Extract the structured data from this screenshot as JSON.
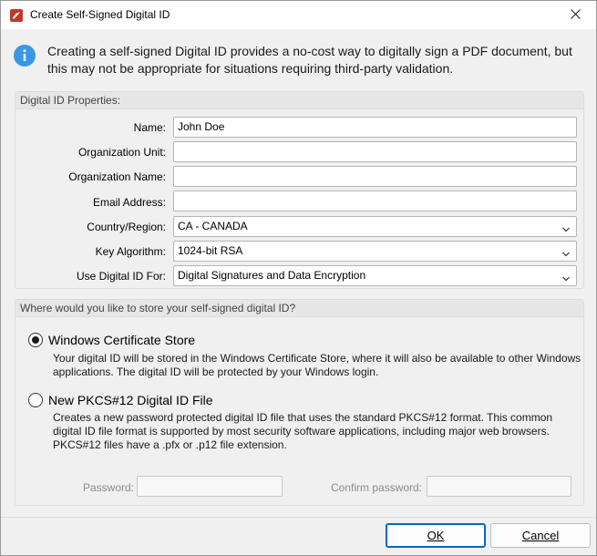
{
  "window": {
    "title": "Create Self-Signed Digital ID"
  },
  "info": {
    "text": "Creating a self-signed Digital ID provides a no-cost way to digitally sign a PDF document, but this may not be appropriate for situations requiring third-party validation."
  },
  "properties": {
    "header": "Digital ID Properties:",
    "name_label": "Name:",
    "name_value": "John Doe",
    "org_unit_label": "Organization Unit:",
    "org_unit_value": "",
    "org_name_label": "Organization Name:",
    "org_name_value": "",
    "email_label": "Email Address:",
    "email_value": "",
    "country_label": "Country/Region:",
    "country_value": "CA - CANADA",
    "key_label": "Key Algorithm:",
    "key_value": "1024-bit RSA",
    "use_label": "Use Digital ID For:",
    "use_value": "Digital Signatures and Data Encryption"
  },
  "storage": {
    "header": "Where would you like to store your self-signed digital ID?",
    "option1_label": "Windows Certificate Store",
    "option1_desc": "Your digital ID will be stored in the Windows Certificate Store, where it will also be available to other Windows applications. The digital ID will be protected by your Windows login.",
    "option2_label": "New PKCS#12 Digital ID File",
    "option2_desc": "Creates a new password protected digital ID file that uses the standard PKCS#12 format. This common digital ID file format is supported by most security software applications, including major web browsers. PKCS#12 files have a .pfx or .p12 file extension.",
    "password_label": "Password:",
    "confirm_label": "Confirm password:"
  },
  "buttons": {
    "ok": "OK",
    "cancel": "Cancel"
  },
  "icons": {
    "app": "pdf-app-icon",
    "info": "info-icon",
    "close": "close-icon",
    "dropdown": "chevron-down-icon"
  },
  "colors": {
    "accent": "#0067c0",
    "info_blue": "#3b97e3",
    "app_red": "#c0392b"
  }
}
